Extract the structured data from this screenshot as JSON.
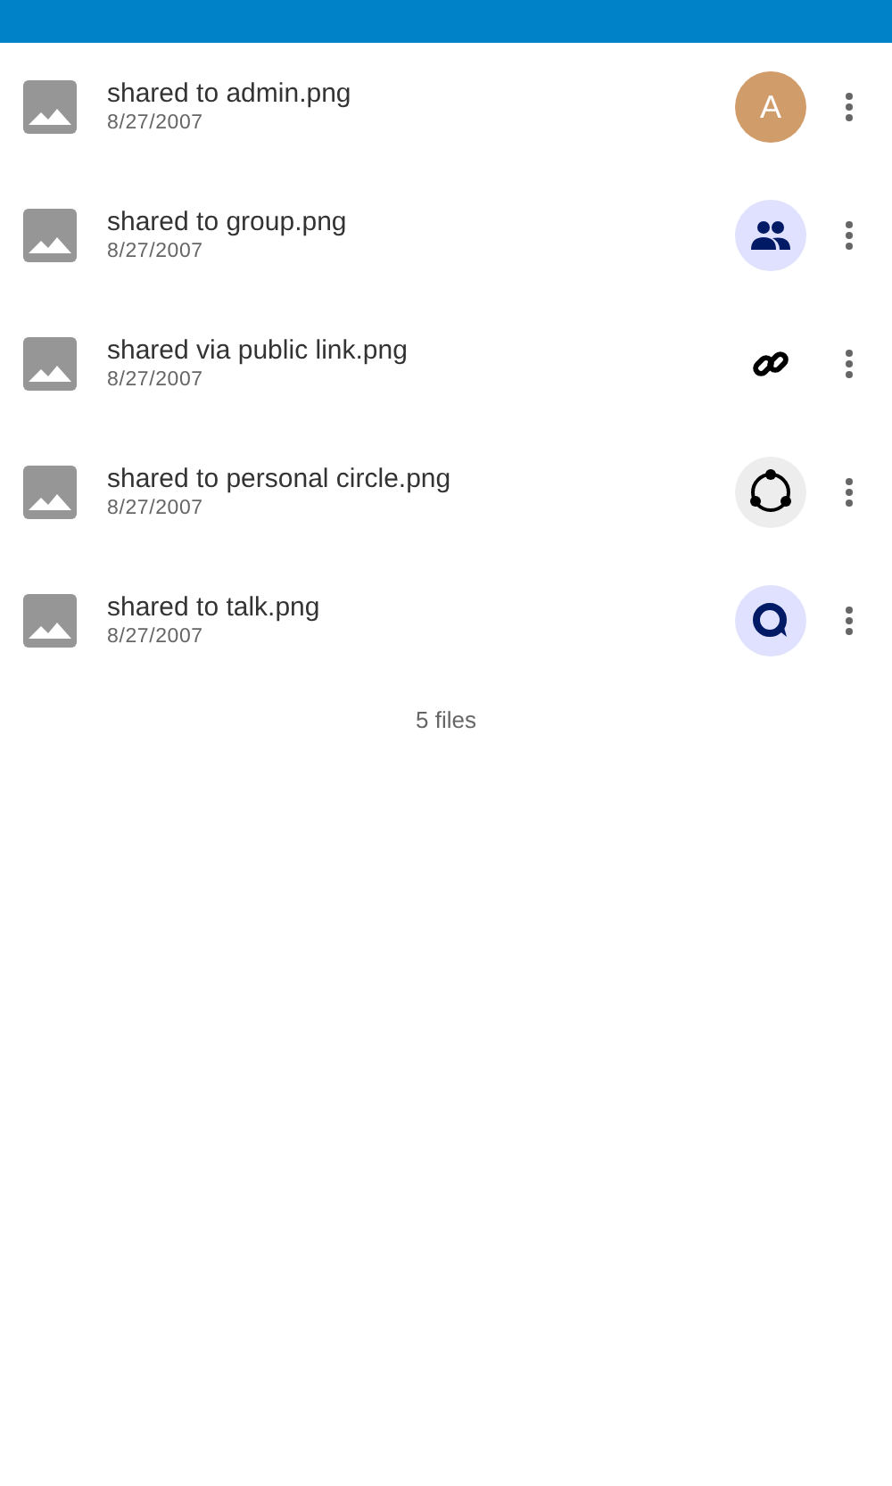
{
  "files": [
    {
      "name": "shared to admin.png",
      "date": "8/27/2007",
      "share": {
        "kind": "avatar",
        "letter": "A",
        "color": "#d09c6a"
      }
    },
    {
      "name": "shared to group.png",
      "date": "8/27/2007",
      "share": {
        "kind": "group"
      }
    },
    {
      "name": "shared via public link.png",
      "date": "8/27/2007",
      "share": {
        "kind": "link"
      }
    },
    {
      "name": "shared to personal circle.png",
      "date": "8/27/2007",
      "share": {
        "kind": "circle"
      }
    },
    {
      "name": "shared to talk.png",
      "date": "8/27/2007",
      "share": {
        "kind": "talk"
      }
    }
  ],
  "footer": "5 files"
}
